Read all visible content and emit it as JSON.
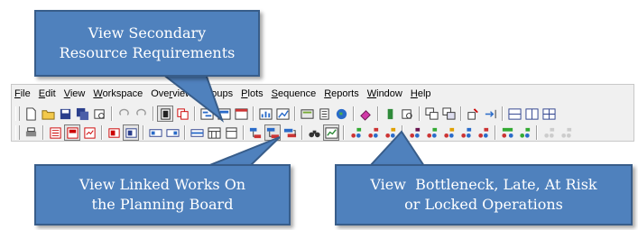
{
  "menu": [
    {
      "label": "File"
    },
    {
      "label": "Edit"
    },
    {
      "label": "View"
    },
    {
      "label": "Workspace"
    },
    {
      "label": "Overview"
    },
    {
      "label": "Groups"
    },
    {
      "label": "Plots"
    },
    {
      "label": "Sequence"
    },
    {
      "label": "Reports"
    },
    {
      "label": "Window"
    },
    {
      "label": "Help"
    }
  ],
  "callouts": {
    "secondary": {
      "line1": "View Secondary",
      "line2": "Resource Requirements"
    },
    "linked": {
      "line1": "View Linked Works On",
      "line2": "the Planning Board"
    },
    "bottleneck": {
      "line1": "View  Bottleneck, Late, At Risk",
      "line2": "or Locked Operations"
    }
  },
  "colors": {
    "callout_fill": "#4f81bd",
    "callout_border": "#385d8a"
  }
}
